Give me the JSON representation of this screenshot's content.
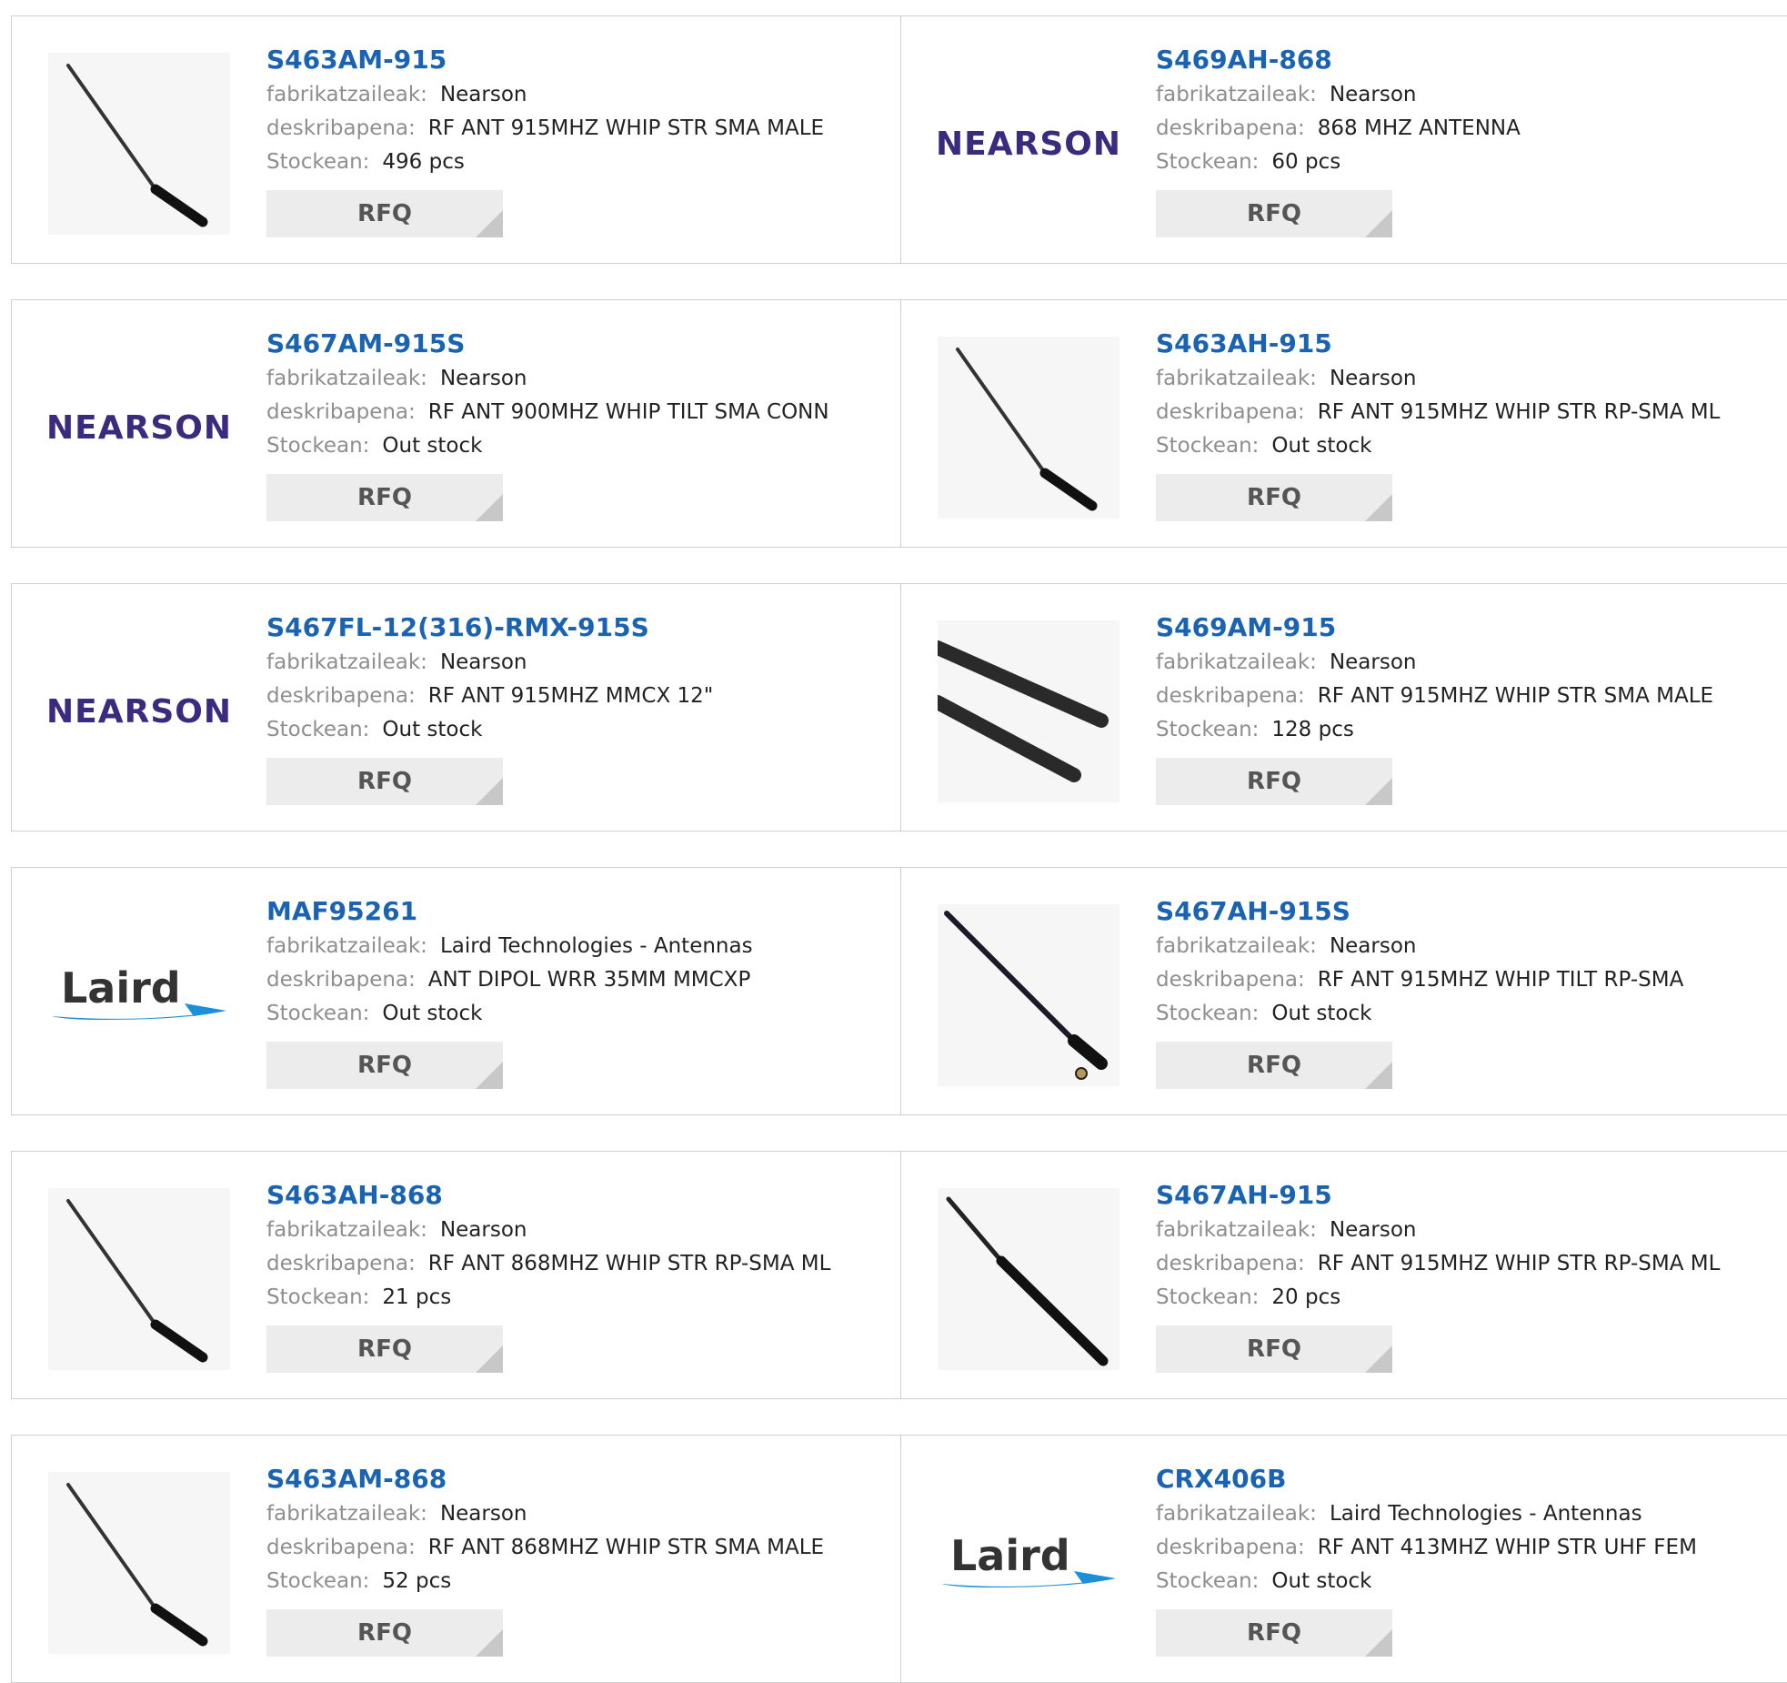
{
  "labels": {
    "manufacturer": "fabrikatzaileak:",
    "description": "deskribapena:",
    "stock": "Stockean:",
    "rfq": "RFQ"
  },
  "colors": {
    "link": "#1a63b3",
    "key": "#8e8e8e",
    "value": "#222222",
    "button_bg": "#ececec",
    "nearson_logo": "#3a2b7e"
  },
  "products": [
    {
      "pn": "S463AM-915",
      "manufacturer": "Nearson",
      "description": "RF ANT 915MHZ WHIP STR SMA MALE",
      "stock": "496 pcs",
      "image": "whip-antenna-photo"
    },
    {
      "pn": "S469AH-868",
      "manufacturer": "Nearson",
      "description": "868 MHZ ANTENNA",
      "stock": "60 pcs",
      "image": "nearson-logo",
      "logo_text": "NEARSON"
    },
    {
      "pn": "S467AM-915S",
      "manufacturer": "Nearson",
      "description": "RF ANT 900MHZ WHIP TILT SMA CONN",
      "stock": "Out stock",
      "image": "nearson-logo",
      "logo_text": "NEARSON"
    },
    {
      "pn": "S463AH-915",
      "manufacturer": "Nearson",
      "description": "RF ANT 915MHZ WHIP STR RP-SMA ML",
      "stock": "Out stock",
      "image": "whip-antenna-photo"
    },
    {
      "pn": "S467FL-12(316)-RMX-915S",
      "manufacturer": "Nearson",
      "description": "RF ANT 915MHZ MMCX 12\"",
      "stock": "Out stock",
      "image": "nearson-logo",
      "logo_text": "NEARSON"
    },
    {
      "pn": "S469AM-915",
      "manufacturer": "Nearson",
      "description": "RF ANT 915MHZ WHIP STR SMA MALE",
      "stock": "128 pcs",
      "image": "double-rod-antenna-photo"
    },
    {
      "pn": "MAF95261",
      "manufacturer": "Laird Technologies - Antennas",
      "description": "ANT DIPOL WRR 35MM MMCXP",
      "stock": "Out stock",
      "image": "laird-logo",
      "logo_text": "Laird"
    },
    {
      "pn": "S467AH-915S",
      "manufacturer": "Nearson",
      "description": "RF ANT 915MHZ WHIP TILT RP-SMA",
      "stock": "Out stock",
      "image": "tilt-antenna-photo"
    },
    {
      "pn": "S463AH-868",
      "manufacturer": "Nearson",
      "description": "RF ANT 868MHZ WHIP STR RP-SMA ML",
      "stock": "21 pcs",
      "image": "whip-antenna-photo"
    },
    {
      "pn": "S467AH-915",
      "manufacturer": "Nearson",
      "description": "RF ANT 915MHZ WHIP STR RP-SMA ML",
      "stock": "20 pcs",
      "image": "thick-whip-antenna-photo"
    },
    {
      "pn": "S463AM-868",
      "manufacturer": "Nearson",
      "description": "RF ANT 868MHZ WHIP STR SMA MALE",
      "stock": "52 pcs",
      "image": "whip-antenna-photo"
    },
    {
      "pn": "CRX406B",
      "manufacturer": "Laird Technologies - Antennas",
      "description": "RF ANT 413MHZ WHIP STR UHF FEM",
      "stock": "Out stock",
      "image": "laird-logo",
      "logo_text": "Laird"
    }
  ]
}
